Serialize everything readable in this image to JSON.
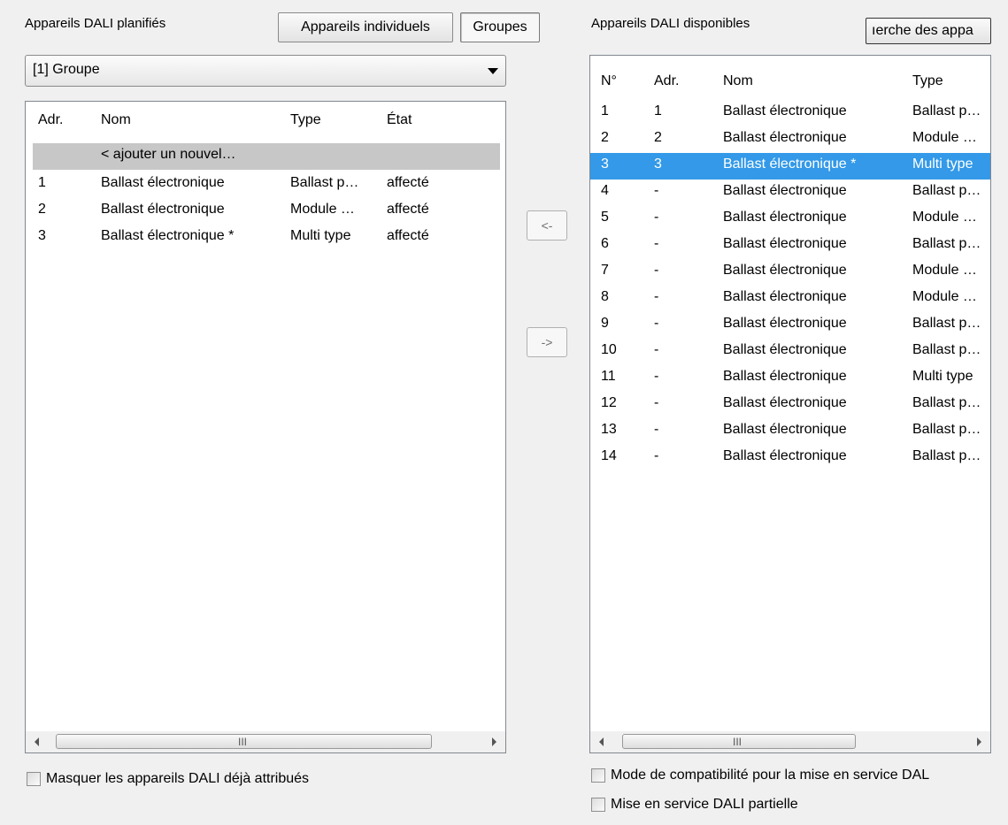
{
  "left_panel": {
    "title": "Appareils DALI planifiés",
    "btn_individual": "Appareils individuels",
    "btn_groups": "Groupes",
    "combo_value": "[1] Groupe",
    "columns": [
      "Adr.",
      "Nom",
      "Type",
      "État"
    ],
    "add_row": "< ajouter un nouvel…",
    "rows": [
      {
        "adr": "1",
        "nom": "Ballast électronique",
        "type": "Ballast p…",
        "etat": "affecté"
      },
      {
        "adr": "2",
        "nom": "Ballast électronique",
        "type": "Module …",
        "etat": "affecté"
      },
      {
        "adr": "3",
        "nom": "Ballast électronique *",
        "type": "Multi type",
        "etat": "affecté"
      }
    ],
    "scroll_grip": "III",
    "hide_checkbox": "Masquer les appareils DALI déjà attribués"
  },
  "middle": {
    "move_left": "<-",
    "move_right": "->"
  },
  "right_panel": {
    "title": "Appareils DALI disponibles",
    "search_button": "ıerche des appa",
    "columns": [
      "N°",
      "Adr.",
      "Nom",
      "Type"
    ],
    "selected_index": 2,
    "rows": [
      {
        "no": "1",
        "adr": "1",
        "nom": "Ballast électronique",
        "type": "Ballast p…"
      },
      {
        "no": "2",
        "adr": "2",
        "nom": "Ballast électronique",
        "type": "Module …"
      },
      {
        "no": "3",
        "adr": "3",
        "nom": "Ballast électronique *",
        "type": "Multi type"
      },
      {
        "no": "4",
        "adr": "-",
        "nom": "Ballast électronique",
        "type": "Ballast p…"
      },
      {
        "no": "5",
        "adr": "-",
        "nom": "Ballast électronique",
        "type": "Module …"
      },
      {
        "no": "6",
        "adr": "-",
        "nom": "Ballast électronique",
        "type": "Ballast p…"
      },
      {
        "no": "7",
        "adr": "-",
        "nom": "Ballast électronique",
        "type": "Module …"
      },
      {
        "no": "8",
        "adr": "-",
        "nom": "Ballast électronique",
        "type": "Module …"
      },
      {
        "no": "9",
        "adr": "-",
        "nom": "Ballast électronique",
        "type": "Ballast p…"
      },
      {
        "no": "10",
        "adr": "-",
        "nom": "Ballast électronique",
        "type": "Ballast p…"
      },
      {
        "no": "11",
        "adr": "-",
        "nom": "Ballast électronique",
        "type": "Multi type"
      },
      {
        "no": "12",
        "adr": "-",
        "nom": "Ballast électronique",
        "type": "Ballast p…"
      },
      {
        "no": "13",
        "adr": "-",
        "nom": "Ballast électronique",
        "type": "Ballast p…"
      },
      {
        "no": "14",
        "adr": "-",
        "nom": "Ballast électronique",
        "type": "Ballast p…"
      }
    ],
    "scroll_grip": "III",
    "compat_checkbox": "Mode de compatibilité pour la mise en service DAL",
    "partial_checkbox": "Mise en service DALI partielle"
  },
  "colors": {
    "selection": "#3399e8",
    "new_row": "#c7c7c7",
    "background": "#f0f0f0"
  }
}
